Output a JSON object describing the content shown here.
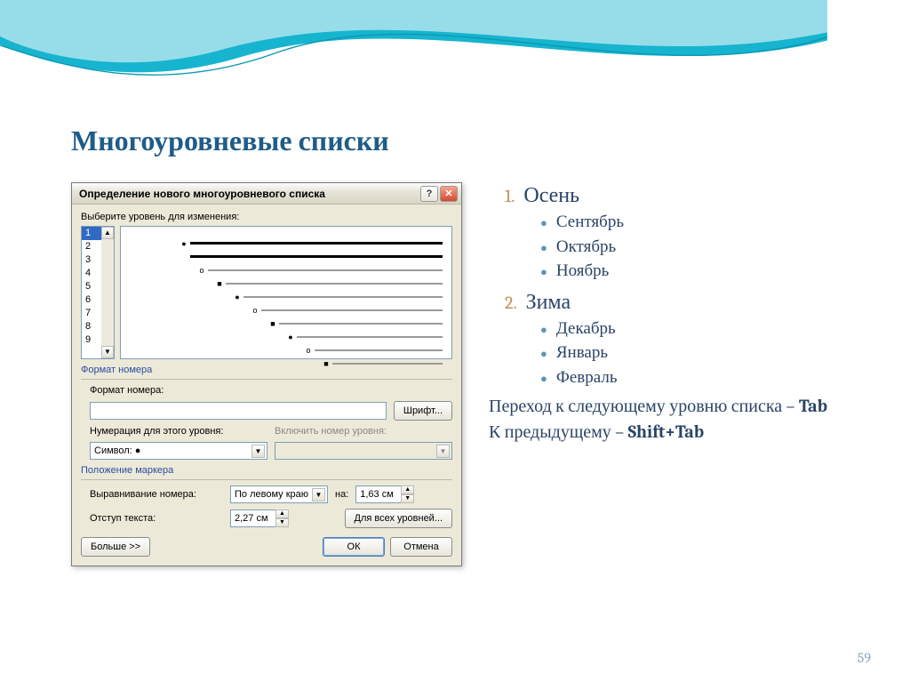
{
  "slide": {
    "title": "Многоуровневые списки",
    "page_number": "59"
  },
  "dialog": {
    "title": "Определение нового многоуровневого списка",
    "help_icon": "?",
    "close_icon": "✕",
    "level_label": "Выберите уровень для изменения:",
    "levels": [
      "1",
      "2",
      "3",
      "4",
      "5",
      "6",
      "7",
      "8",
      "9"
    ],
    "selected_level": "1",
    "section_format": "Формат номера",
    "format_label": "Формат номера:",
    "font_button": "Шрифт...",
    "numbering_label": "Нумерация для этого уровня:",
    "numbering_value": "Символ: ●",
    "include_label": "Включить номер уровня:",
    "section_position": "Положение маркера",
    "align_label": "Выравнивание номера:",
    "align_value": "По левому краю",
    "at_label": "на:",
    "at_value": "1,63 см",
    "indent_label": "Отступ текста:",
    "indent_value": "2,27 см",
    "all_levels_button": "Для всех уровней...",
    "more_button": "Больше >>",
    "ok_button": "ОК",
    "cancel_button": "Отмена"
  },
  "list": {
    "items": [
      {
        "num": "1.",
        "label": "Осень",
        "sub": [
          "Сентябрь",
          "Октябрь",
          "Ноябрь"
        ]
      },
      {
        "num": "2.",
        "label": "Зима",
        "sub": [
          "Декабрь",
          "Январь",
          "Февраль"
        ]
      }
    ],
    "note1_a": "Переход к следующему уровню списка – ",
    "note1_b": "Tab",
    "note2_a": "К предыдущему – ",
    "note2_b": "Shift+Tab"
  }
}
